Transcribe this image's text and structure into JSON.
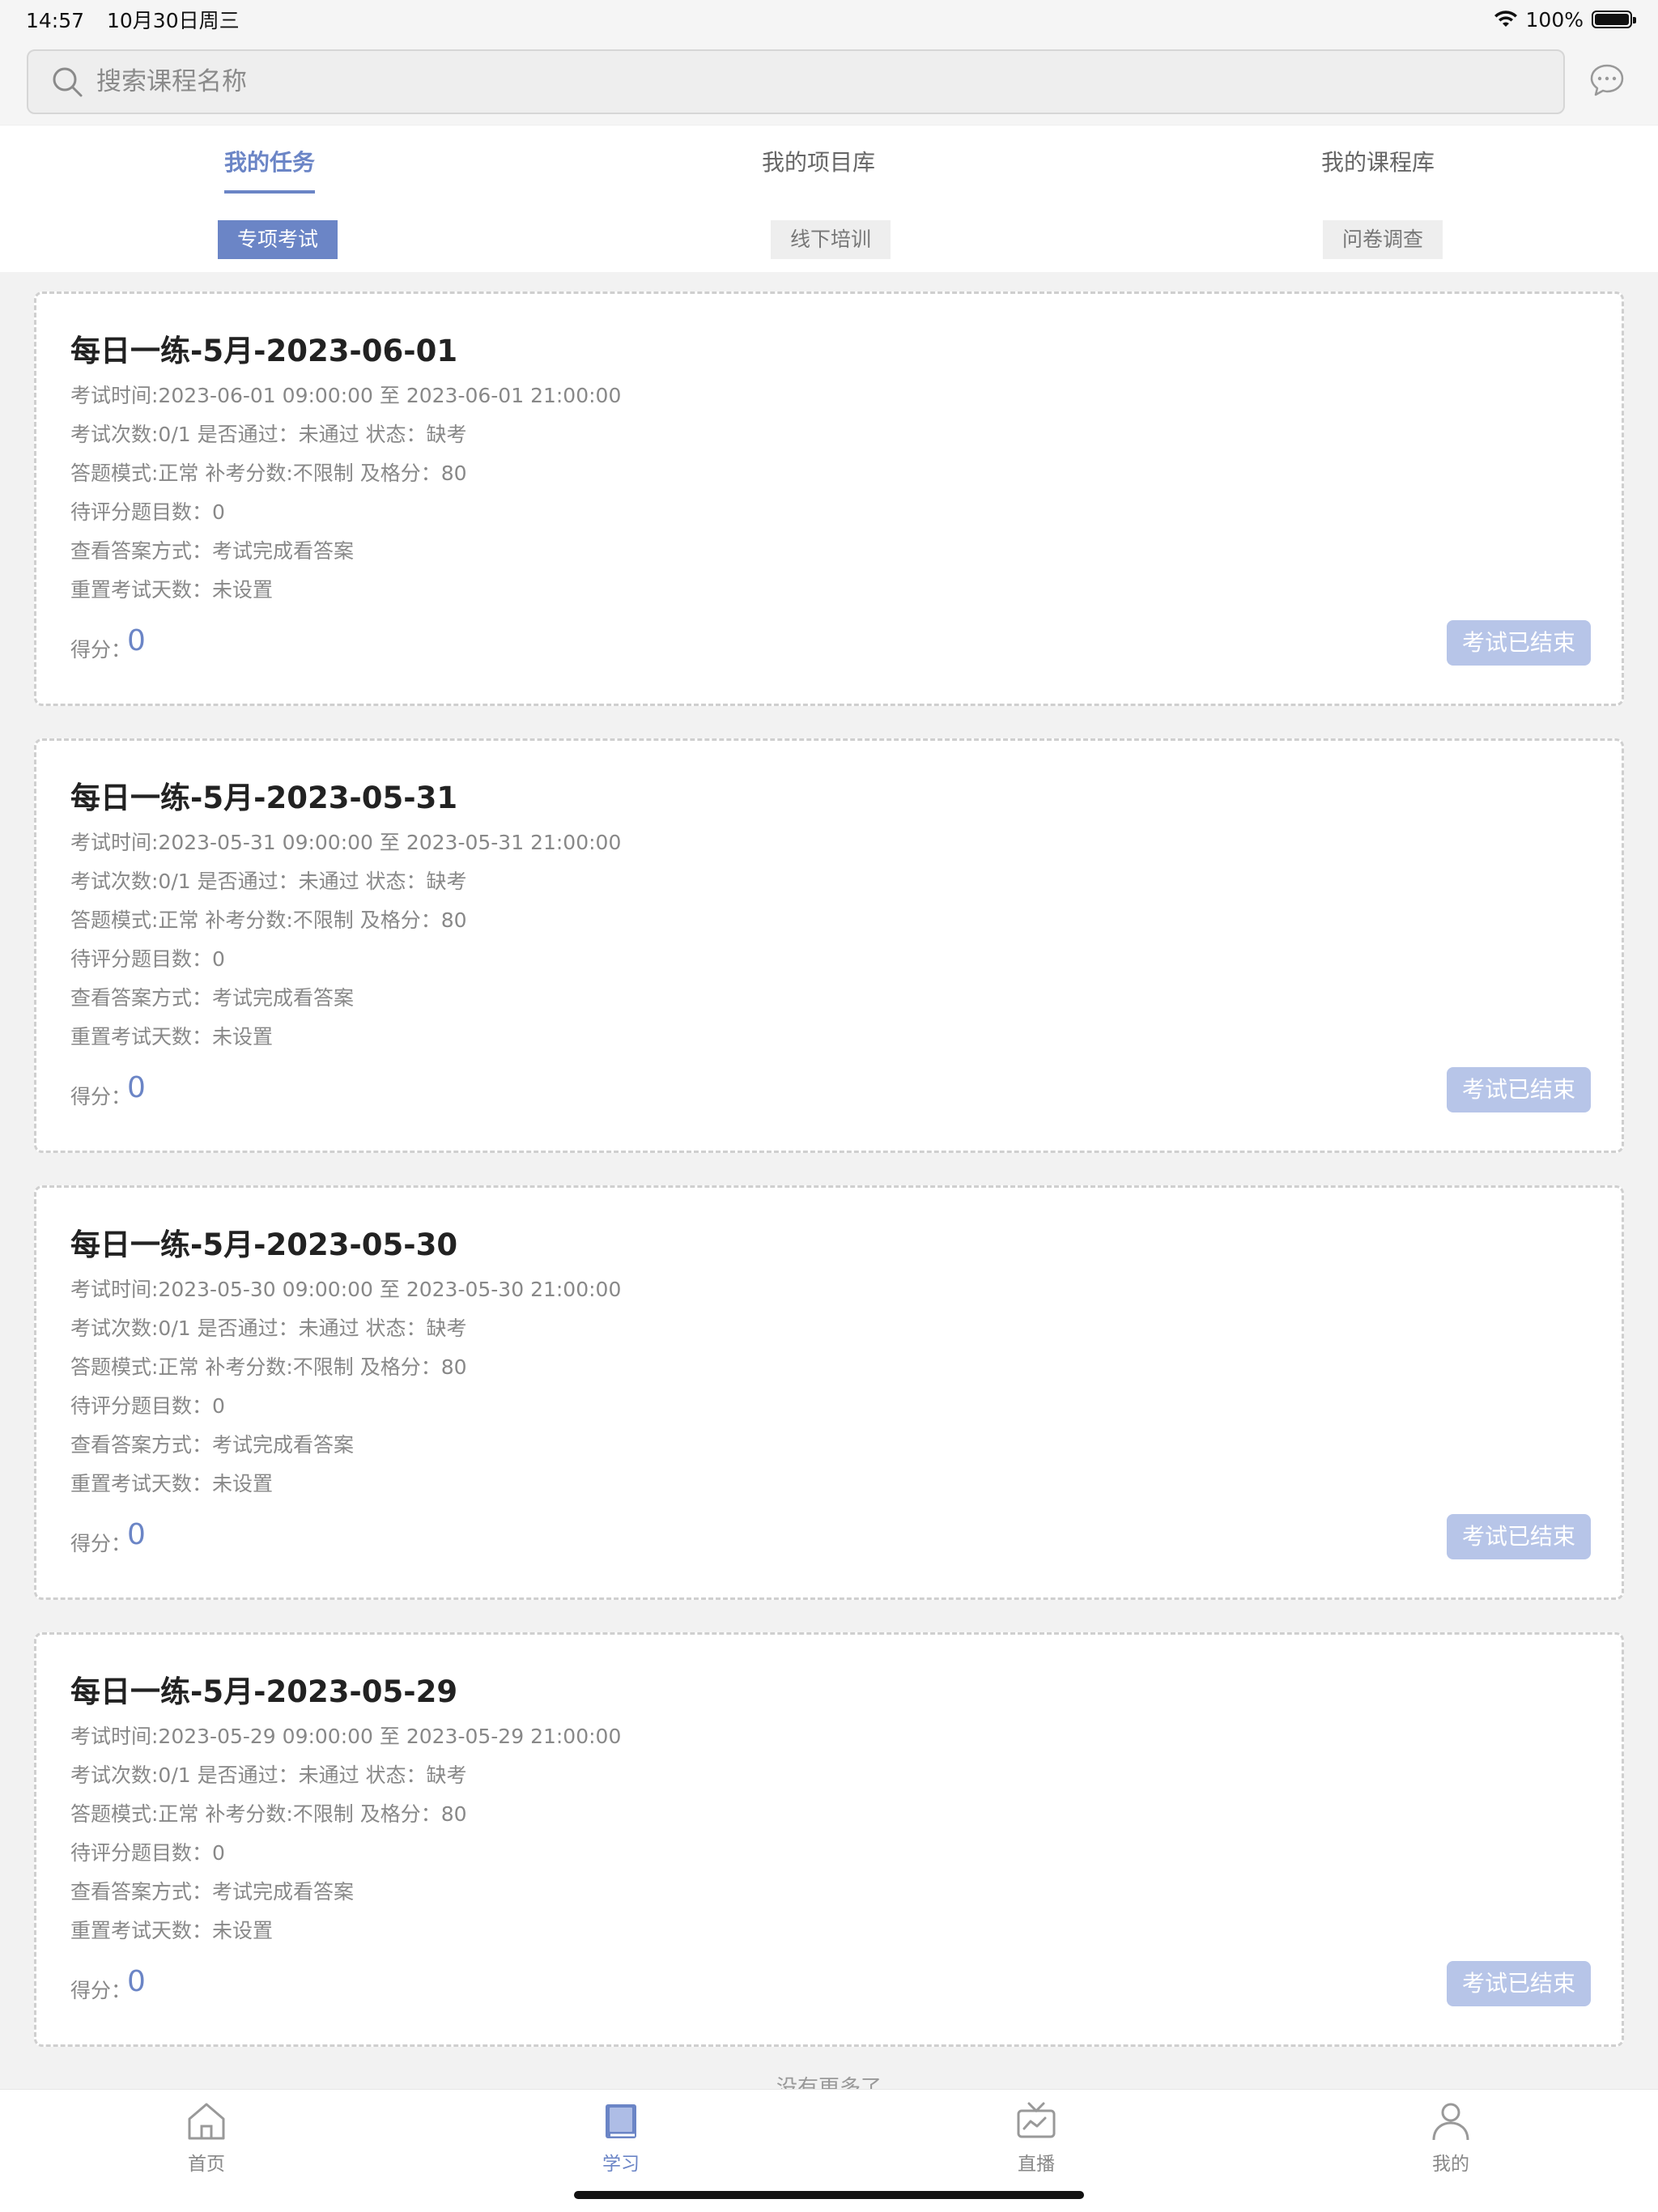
{
  "status_bar": {
    "time": "14:57",
    "date": "10月30日周三",
    "battery": "100%"
  },
  "search": {
    "placeholder": "搜索课程名称"
  },
  "tabs": [
    {
      "label": "我的任务",
      "active": true
    },
    {
      "label": "我的项目库",
      "active": false
    },
    {
      "label": "我的课程库",
      "active": false
    }
  ],
  "subtabs": [
    {
      "label": "专项考试",
      "active": true
    },
    {
      "label": "线下培训",
      "active": false
    },
    {
      "label": "问卷调查",
      "active": false
    }
  ],
  "exams": [
    {
      "title": "每日一练-5月-2023-06-01",
      "time": "考试时间:2023-06-01 09:00:00 至 2023-06-01 21:00:00",
      "attempts": "考试次数:0/1   是否通过：未通过   状态：缺考",
      "mode": "答题模式:正常   补考分数:不限制   及格分：80",
      "pending": "待评分题目数：0",
      "answer_view": "查看答案方式：考试完成看答案",
      "reset_days": "重置考试天数：未设置",
      "score_label": "得分：",
      "score": "0",
      "button": "考试已结束"
    },
    {
      "title": "每日一练-5月-2023-05-31",
      "time": "考试时间:2023-05-31 09:00:00 至 2023-05-31 21:00:00",
      "attempts": "考试次数:0/1   是否通过：未通过   状态：缺考",
      "mode": "答题模式:正常   补考分数:不限制   及格分：80",
      "pending": "待评分题目数：0",
      "answer_view": "查看答案方式：考试完成看答案",
      "reset_days": "重置考试天数：未设置",
      "score_label": "得分：",
      "score": "0",
      "button": "考试已结束"
    },
    {
      "title": "每日一练-5月-2023-05-30",
      "time": "考试时间:2023-05-30 09:00:00 至 2023-05-30 21:00:00",
      "attempts": "考试次数:0/1   是否通过：未通过   状态：缺考",
      "mode": "答题模式:正常   补考分数:不限制   及格分：80",
      "pending": "待评分题目数：0",
      "answer_view": "查看答案方式：考试完成看答案",
      "reset_days": "重置考试天数：未设置",
      "score_label": "得分：",
      "score": "0",
      "button": "考试已结束"
    },
    {
      "title": "每日一练-5月-2023-05-29",
      "time": "考试时间:2023-05-29 09:00:00 至 2023-05-29 21:00:00",
      "attempts": "考试次数:0/1   是否通过：未通过   状态：缺考",
      "mode": "答题模式:正常   补考分数:不限制   及格分：80",
      "pending": "待评分题目数：0",
      "answer_view": "查看答案方式：考试完成看答案",
      "reset_days": "重置考试天数：未设置",
      "score_label": "得分：",
      "score": "0",
      "button": "考试已结束"
    }
  ],
  "list_footer": "没有更多了",
  "bottom_nav": [
    {
      "label": "首页",
      "icon": "home-icon",
      "active": false
    },
    {
      "label": "学习",
      "icon": "book-icon",
      "active": true
    },
    {
      "label": "直播",
      "icon": "tv-icon",
      "active": false
    },
    {
      "label": "我的",
      "icon": "user-icon",
      "active": false
    }
  ],
  "colors": {
    "accent": "#6b85c6",
    "button_disabled": "#b7c5e8",
    "list_bg": "#f2f2f2"
  }
}
